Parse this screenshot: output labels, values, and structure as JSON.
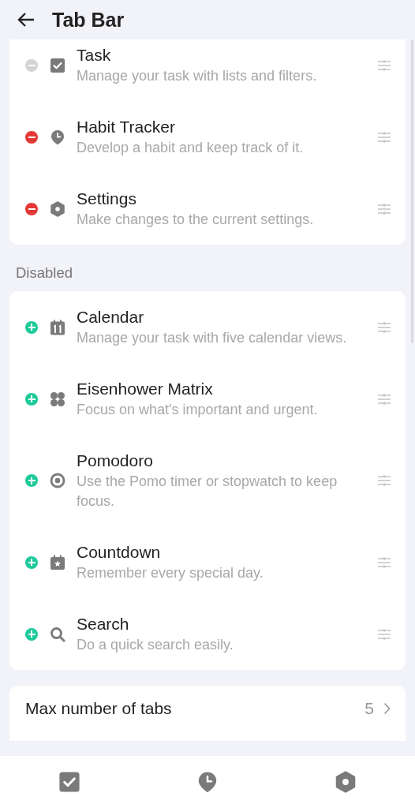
{
  "header": {
    "title": "Tab Bar"
  },
  "enabled_items": [
    {
      "kind": "task",
      "title": "Task",
      "description": "Manage your task with lists and filters.",
      "removable": true,
      "disabled": true
    },
    {
      "kind": "habit",
      "title": "Habit Tracker",
      "description": "Develop a habit and keep track of it.",
      "removable": true,
      "disabled": false
    },
    {
      "kind": "settings",
      "title": "Settings",
      "description": "Make changes to the current settings.",
      "removable": true,
      "disabled": false
    }
  ],
  "disabled_section": {
    "label": "Disabled"
  },
  "disabled_items": [
    {
      "kind": "calendar",
      "title": "Calendar",
      "description": "Manage your task with five calendar views.",
      "removable": false,
      "disabled": false
    },
    {
      "kind": "matrix",
      "title": "Eisenhower Matrix",
      "description": "Focus on what's important and urgent.",
      "removable": false,
      "disabled": false
    },
    {
      "kind": "pomodoro",
      "title": "Pomodoro",
      "description": "Use the Pomo timer or stopwatch to keep focus.",
      "removable": false,
      "disabled": false
    },
    {
      "kind": "countdown",
      "title": "Countdown",
      "description": "Remember every special day.",
      "removable": false,
      "disabled": false
    },
    {
      "kind": "search",
      "title": "Search",
      "description": "Do a quick search easily.",
      "removable": false,
      "disabled": false
    }
  ],
  "max_tabs": {
    "label": "Max number of tabs",
    "value": "5"
  },
  "bottom_nav": [
    {
      "kind": "task"
    },
    {
      "kind": "habit"
    },
    {
      "kind": "settings"
    }
  ]
}
